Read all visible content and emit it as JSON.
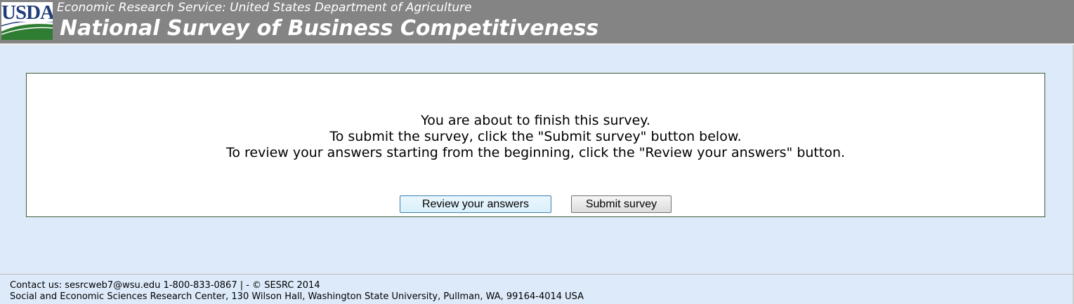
{
  "header": {
    "logo_text": "USDA",
    "subtitle": "Economic Research Service: United States Department of Agriculture",
    "title": "National Survey of Business Competitiveness"
  },
  "main": {
    "message_lines": [
      "You are about to finish this survey.",
      "To submit the survey, click the \"Submit survey\" button below.",
      "To review your answers starting from the beginning, click the \"Review your answers\" button."
    ],
    "review_button": "Review your answers",
    "submit_button": "Submit survey"
  },
  "footer": {
    "contact_line": "Contact us: sesrcweb7@wsu.edu 1-800-833-0867 | - © SESRC 2014",
    "address_line": "Social and Economic Sciences Research Center, 130 Wilson Hall, Washington State University, Pullman, WA, 99164-4014 USA"
  },
  "colors": {
    "header_bg": "#848484",
    "page_bg": "#ddeafa",
    "logo_blue": "#1f3d7a",
    "logo_green": "#2e7d32"
  }
}
